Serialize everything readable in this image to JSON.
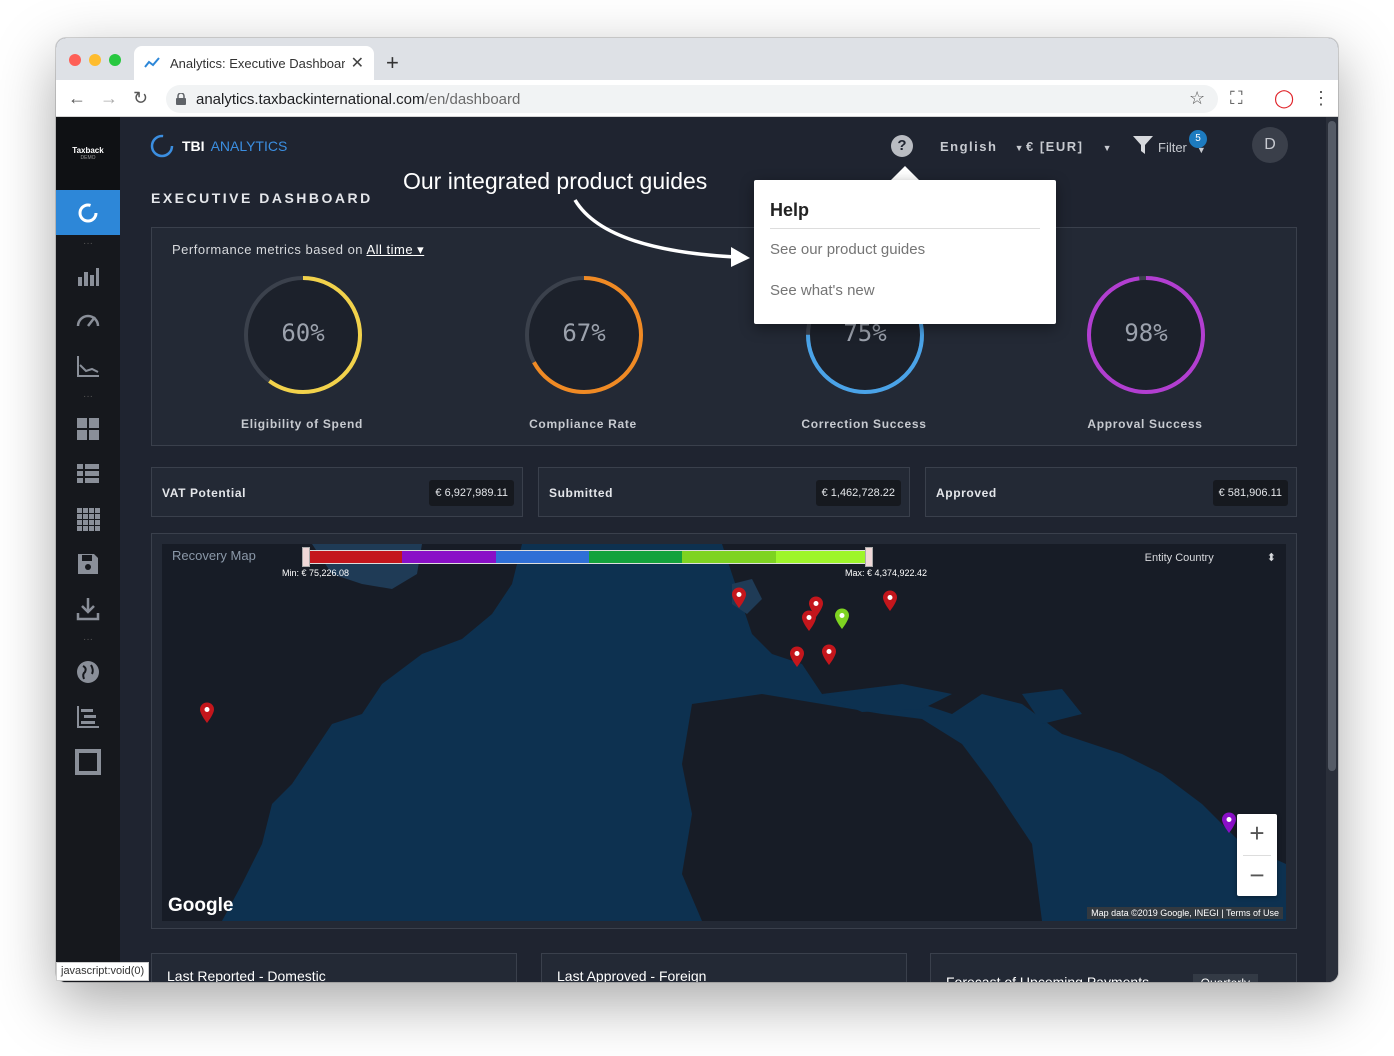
{
  "browser": {
    "tab_title": "Analytics: Executive Dashboard",
    "tab_close": "✕",
    "new_tab": "+",
    "url_host": "analytics.taxbackinternational.com",
    "url_path": "/en/dashboard"
  },
  "sidebar": {
    "brand": "Taxback",
    "brand_sub": "DEMO",
    "dots": "···"
  },
  "topbar": {
    "logo": "TBI",
    "logo_sub": "ANALYTICS",
    "help_icon": "?",
    "language": "English",
    "currency": "€ [EUR]",
    "filter": "Filter",
    "filter_count": "5",
    "avatar": "D"
  },
  "page_title": "EXECUTIVE DASHBOARD",
  "metrics": {
    "label": "Performance metrics based on",
    "period": "All time",
    "gauges": [
      {
        "name": "Eligibility of Spend",
        "value": "60%",
        "pct": 60,
        "color": "#f2d24b"
      },
      {
        "name": "Compliance Rate",
        "value": "67%",
        "pct": 67,
        "color": "#f08a24"
      },
      {
        "name": "Correction Success",
        "value": "75%",
        "pct": 75,
        "color": "#4aa3e8"
      },
      {
        "name": "Approval Success",
        "value": "98%",
        "pct": 98,
        "color": "#b23ed1"
      }
    ]
  },
  "kpis": [
    {
      "label": "VAT Potential",
      "value": "€ 6,927,989.11"
    },
    {
      "label": "Submitted",
      "value": "€ 1,462,728.22"
    },
    {
      "label": "Approved",
      "value": "€ 581,906.11"
    }
  ],
  "map": {
    "title": "Recovery Map",
    "min_label": "Min: € 75,226.08",
    "max_label": "Max: € 4,374,922.42",
    "entity_select": "Entity Country",
    "google": "Google",
    "attribution": "Map data ©2019 Google, INEGI",
    "terms": "Terms of Use",
    "legend_colors": [
      "#c4161c",
      "#8a0fc7",
      "#2f6fd6",
      "#13a23c",
      "#7ed321",
      "#9ef52a"
    ],
    "zoom_in": "+",
    "zoom_out": "−"
  },
  "bottom_cards": [
    {
      "title": "Last Reported - Domestic"
    },
    {
      "title": "Last Approved - Foreign"
    },
    {
      "title": "Forecast of Upcoming Payments",
      "select": "Quarterly"
    }
  ],
  "status_bar": "javascript:void(0)",
  "help_popover": {
    "title": "Help",
    "items": [
      "See our product guides",
      "See what's new"
    ]
  },
  "annotation": "Our integrated product guides"
}
